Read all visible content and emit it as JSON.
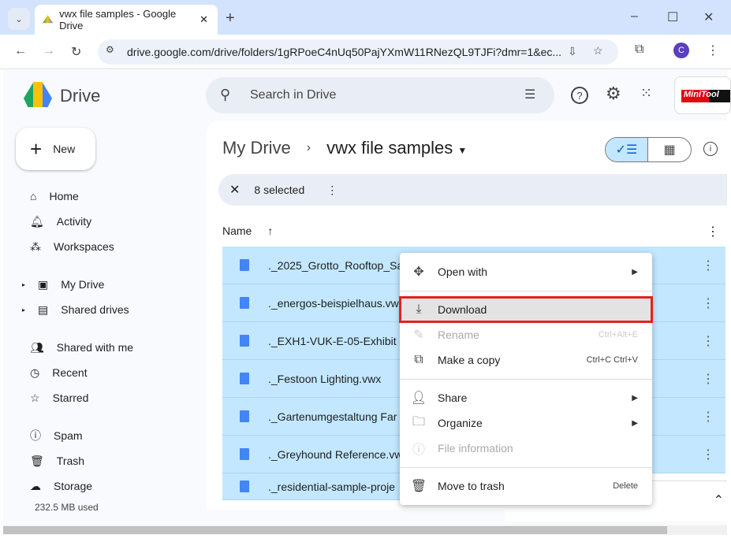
{
  "browser": {
    "tab_title": "vwx file samples - Google Drive",
    "url": "drive.google.com/drive/folders/1gRPoeC4nUq50PajYXmW11RNezQL9TJFi?dmr=1&ec...",
    "profile_initial": "C"
  },
  "header": {
    "product": "Drive",
    "search_placeholder": "Search in Drive",
    "brand": "MiniTool"
  },
  "sidebar": {
    "new_label": "New",
    "items": [
      {
        "label": "Home"
      },
      {
        "label": "Activity"
      },
      {
        "label": "Workspaces"
      },
      {
        "label": "My Drive"
      },
      {
        "label": "Shared drives"
      },
      {
        "label": "Shared with me"
      },
      {
        "label": "Recent"
      },
      {
        "label": "Starred"
      },
      {
        "label": "Spam"
      },
      {
        "label": "Trash"
      },
      {
        "label": "Storage"
      }
    ],
    "storage_used": "232.5 MB used"
  },
  "main": {
    "breadcrumb_root": "My Drive",
    "folder": "vwx file samples",
    "selection": "8 selected",
    "column_name": "Name",
    "files": [
      "._2025_Grotto_Rooftop_Sa",
      "._energos-beispielhaus.vw",
      "._EXH1-VUK-E-05-Exhibit",
      "._Festoon Lighting.vwx",
      "._Gartenumgestaltung Far",
      "._Greyhound Reference.vw",
      "._residential-sample-proje"
    ]
  },
  "context_menu": {
    "items": [
      {
        "label": "Open with",
        "icon": "open-with-icon",
        "submenu": true
      },
      {
        "label": "Download",
        "icon": "download-icon",
        "highlighted": true
      },
      {
        "label": "Rename",
        "icon": "rename-icon",
        "shortcut": "Ctrl+Alt+E",
        "disabled": true
      },
      {
        "label": "Make a copy",
        "icon": "copy-icon",
        "shortcut": "Ctrl+C Ctrl+V"
      },
      {
        "label": "Share",
        "icon": "share-icon",
        "submenu": true
      },
      {
        "label": "Organize",
        "icon": "folder-icon",
        "submenu": true
      },
      {
        "label": "File information",
        "icon": "info-icon",
        "disabled": true
      },
      {
        "label": "Move to trash",
        "icon": "trash-icon",
        "shortcut": "Delete"
      }
    ]
  },
  "colors": {
    "selected_row": "#c2e7ff",
    "highlight_border": "#e8201a",
    "accent": "#0b57d0"
  }
}
